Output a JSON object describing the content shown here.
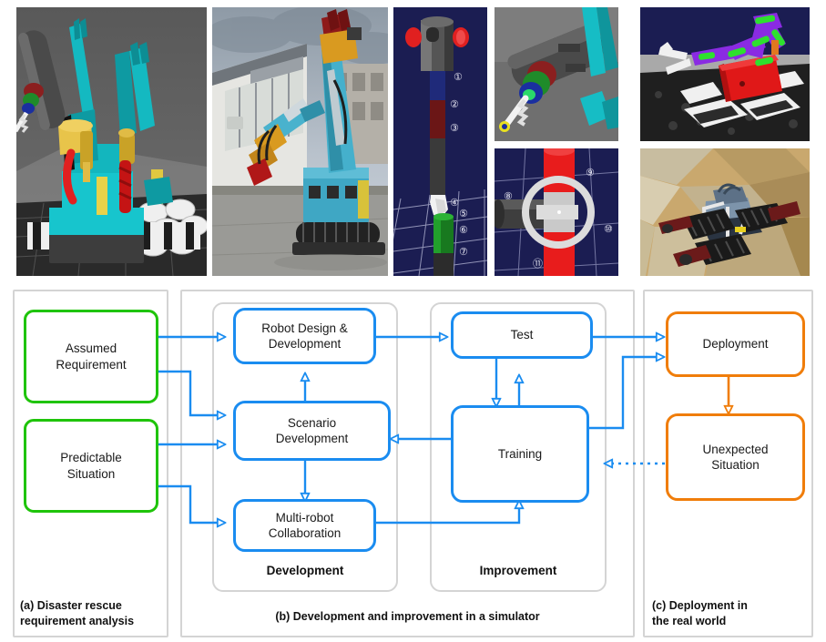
{
  "figure": {
    "photos": [
      {
        "name": "simulated-excavator-dual-arm",
        "caption": "Simulated dual-arm disaster response excavator in simulator"
      },
      {
        "name": "real-excavator-photo",
        "caption": "Real double-front construction machine outdoors"
      },
      {
        "name": "simulated-arm-link-annotated",
        "caption": "Annotated simulated manipulator links"
      },
      {
        "name": "simulated-drill-endeffector",
        "caption": "Close-up of simulated drill end effector"
      },
      {
        "name": "simulated-joint-annotated",
        "caption": "Annotated simulated joint assembly"
      },
      {
        "name": "simulated-tracked-robot-arm",
        "caption": "Simulated tracked mobile robot with purple manipulator"
      },
      {
        "name": "real-tracked-robot-photo",
        "caption": "Real tracked crawler robot on stepfield terrain"
      }
    ],
    "annotation_labels": [
      "①",
      "②",
      "③",
      "④",
      "⑤",
      "⑥",
      "⑦",
      "⑧",
      "⑨",
      "⑩",
      "⑪"
    ]
  },
  "colors": {
    "green": "#1fc40a",
    "blue": "#1a8cf0",
    "orange": "#f07d0a",
    "panel_border": "#d4d4d4",
    "text": "#1a1a1a"
  },
  "panels": {
    "a": {
      "caption_line1": "(a) Disaster rescue",
      "caption_line2": "requirement analysis"
    },
    "b": {
      "caption": "(b) Development and improvement in a simulator"
    },
    "c": {
      "caption_line1": "(c) Deployment in",
      "caption_line2": "the real world"
    }
  },
  "subpanels": {
    "development": {
      "label": "Development"
    },
    "improvement": {
      "label": "Improvement"
    }
  },
  "nodes": {
    "assumed_requirement": {
      "line1": "Assumed",
      "line2": "Requirement"
    },
    "predictable_situation": {
      "line1": "Predictable",
      "line2": "Situation"
    },
    "robot_design": {
      "line1": "Robot Design &",
      "line2": "Development"
    },
    "scenario_development": {
      "line1": "Scenario",
      "line2": "Development"
    },
    "multirobot_collaboration": {
      "line1": "Multi-robot",
      "line2": "Collaboration"
    },
    "test": {
      "line1": "Test",
      "line2": ""
    },
    "training": {
      "line1": "Training",
      "line2": ""
    },
    "deployment": {
      "line1": "Deployment",
      "line2": ""
    },
    "unexpected_situation": {
      "line1": "Unexpected",
      "line2": "Situation"
    }
  },
  "edges": [
    {
      "name": "assumed-requirement-to-robot-design",
      "style": "solid",
      "color": "#1a8cf0"
    },
    {
      "name": "assumed-requirement-to-scenario-development",
      "style": "solid",
      "color": "#1a8cf0"
    },
    {
      "name": "predictable-situation-to-scenario-development",
      "style": "solid",
      "color": "#1a8cf0"
    },
    {
      "name": "predictable-situation-to-multirobot-collaboration",
      "style": "solid",
      "color": "#1a8cf0"
    },
    {
      "name": "scenario-development-to-robot-design",
      "style": "solid",
      "color": "#1a8cf0"
    },
    {
      "name": "scenario-development-to-multirobot-collaboration",
      "style": "solid",
      "color": "#1a8cf0"
    },
    {
      "name": "robot-design-to-test",
      "style": "solid",
      "color": "#1a8cf0"
    },
    {
      "name": "training-to-test",
      "style": "solid",
      "color": "#1a8cf0"
    },
    {
      "name": "test-to-training",
      "style": "solid",
      "color": "#1a8cf0"
    },
    {
      "name": "multirobot-collaboration-to-training",
      "style": "solid",
      "color": "#1a8cf0"
    },
    {
      "name": "training-to-scenario-development",
      "style": "solid",
      "color": "#1a8cf0"
    },
    {
      "name": "test-to-deployment",
      "style": "solid",
      "color": "#1a8cf0"
    },
    {
      "name": "training-to-deployment",
      "style": "solid",
      "color": "#1a8cf0"
    },
    {
      "name": "deployment-to-unexpected-situation",
      "style": "solid",
      "color": "#f07d0a"
    },
    {
      "name": "unexpected-situation-to-training",
      "style": "dotted",
      "color": "#1a8cf0"
    }
  ]
}
